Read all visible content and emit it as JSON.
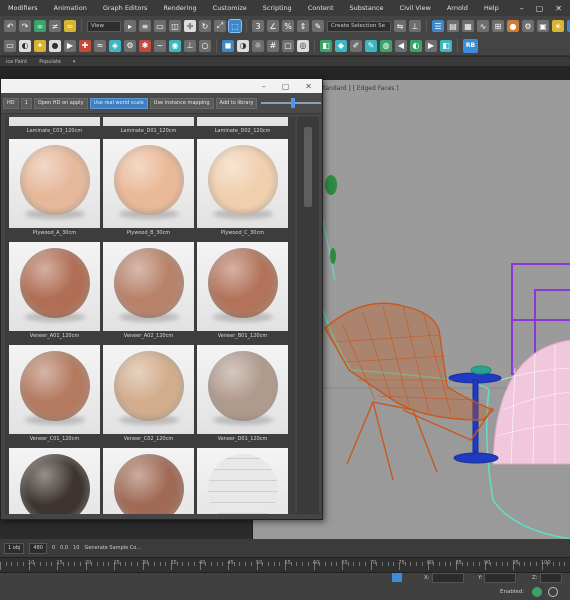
{
  "menubar": {
    "items": [
      "Modifiers",
      "Animation",
      "Graph Editors",
      "Rendering",
      "Customize",
      "Scripting",
      "Content",
      "Substance",
      "Civil View",
      "Arnold",
      "Help"
    ]
  },
  "toolbar": {
    "view_dropdown": "View",
    "selection_set_dropdown": "Create Selection Se",
    "ribbon_button": "RB"
  },
  "subbar": {
    "left_label": "ice Paint",
    "right_label": "Populate"
  },
  "viewport": {
    "label": "tandard ] [ Edged Faces ]"
  },
  "material_browser": {
    "toolbar": {
      "button_hd": "HD",
      "button_1": "1",
      "open_hd": "Open HD on apply",
      "real_world": "Use real world scale",
      "instance_mapping": "Use instance mapping",
      "add_library": "Add to library"
    },
    "top_labels": [
      "Laminate_C03_120cm",
      "Laminate_D01_120cm",
      "Laminate_D02_120cm"
    ],
    "rows": [
      {
        "labels": [
          "Plywood_A_30cm",
          "Plywood_B_30cm",
          "Plywood_C_30cm"
        ],
        "colors": [
          "#e6b89a",
          "#eab997",
          "#f0cfae"
        ]
      },
      {
        "labels": [
          "Veneer_A01_120cm",
          "Veneer_A02_120cm",
          "Veneer_B01_120cm"
        ],
        "colors": [
          "#b06e54",
          "#b8826a",
          "#b2735a"
        ]
      },
      {
        "labels": [
          "Veneer_C01_120cm",
          "Veneer_C02_120cm",
          "Veneer_D01_120cm"
        ],
        "colors": [
          "#b47a60",
          "#d2ad8c",
          "#b09a8c"
        ]
      },
      {
        "labels": [
          "",
          "",
          ""
        ],
        "colors": [
          "#3e3530",
          "#a06a55",
          "#e0e0e0"
        ]
      }
    ]
  },
  "status": {
    "field_a": "1 obj",
    "field_b": "480",
    "field_c": "0",
    "field_d": "0.0",
    "field_e": "10",
    "hint": "Generate Sample Co...",
    "x_label": "X:",
    "y_label": "Y:",
    "z_label": "Z:",
    "enabled": "Enabled:",
    "timeline_labels": [
      "10",
      "15",
      "20",
      "25",
      "30",
      "35",
      "40",
      "45",
      "50",
      "55",
      "60",
      "65",
      "70",
      "75",
      "80",
      "85",
      "90",
      "95",
      "100"
    ]
  },
  "colors": {
    "accent_blue": "#3f7fc2",
    "viewport_bg": "#9b9b9b",
    "chair_orange": "#c8581c",
    "dome_pink": "#f0c7dc",
    "frame_purple": "#8a38d8"
  }
}
